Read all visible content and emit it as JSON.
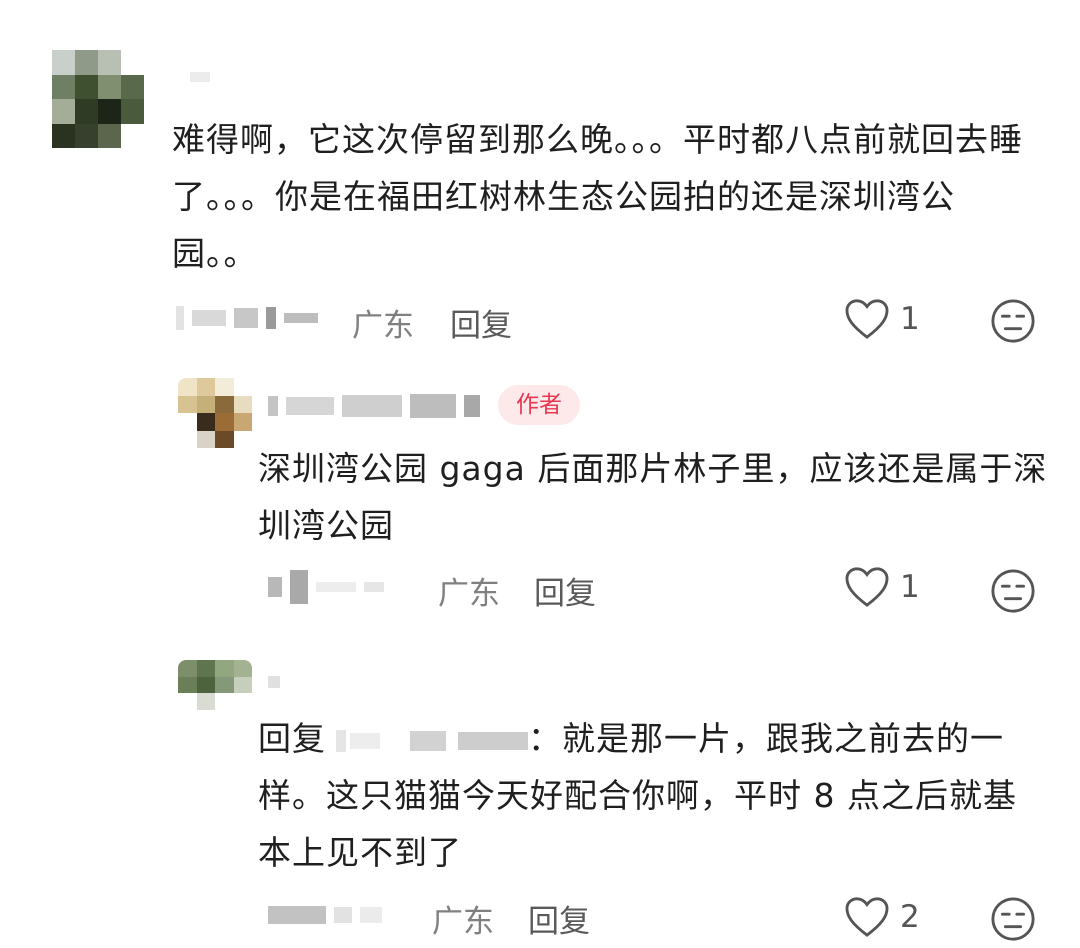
{
  "comments": [
    {
      "text": "难得啊，它这次停留到那么晚。。。平时都八点前就回去睡了。。。你是在福田红树林生态公园拍的还是深圳湾公园。。",
      "location": "广东",
      "reply_label": "回复",
      "likes": "1"
    }
  ],
  "replies": [
    {
      "badge": "作者",
      "text": "深圳湾公园 gaga 后面那片林子里，应该还是属于深圳湾公园",
      "location": "广东",
      "reply_label": "回复",
      "likes": "1"
    },
    {
      "reply_prefix": "回复",
      "text": "：就是那一片，跟我之前去的一样。这只猫猫今天好配合你啊，平时 8 点之后就基本上见不到了",
      "location": "广东",
      "reply_label": "回复",
      "likes": "2"
    }
  ],
  "icons": {
    "like": "heart-outline-icon",
    "reaction": "meh-face-icon"
  },
  "colors": {
    "author_badge_bg": "#fde9ea",
    "author_badge_text": "#e8384f"
  }
}
